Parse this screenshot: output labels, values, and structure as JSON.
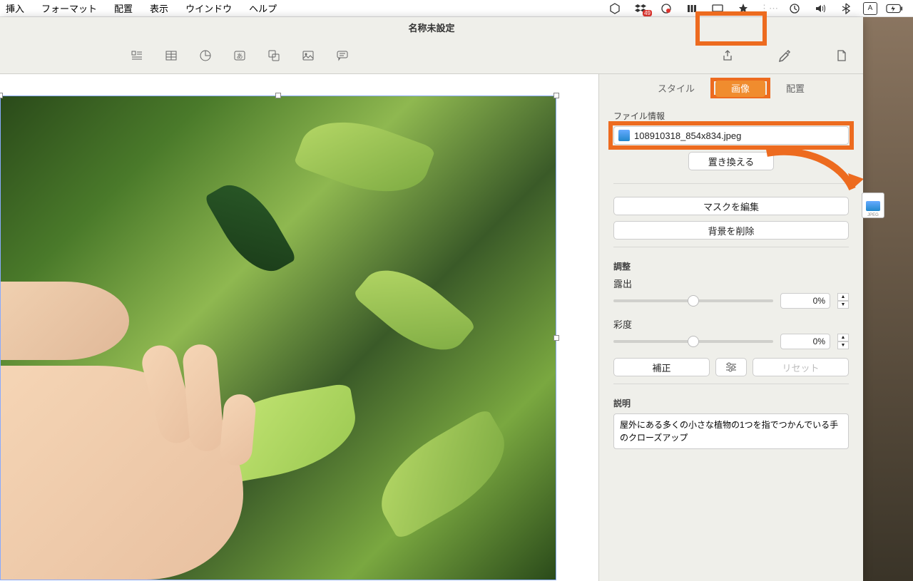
{
  "menubar": {
    "items": [
      "挿入",
      "フォーマット",
      "配置",
      "表示",
      "ウインドウ",
      "ヘルプ"
    ],
    "badge": "49"
  },
  "window": {
    "title": "名称未設定"
  },
  "inspector": {
    "subtabs": {
      "style": "スタイル",
      "image": "画像",
      "arrange": "配置"
    },
    "file_section_label": "ファイル情報",
    "filename": "108910318_854x834.jpeg",
    "replace_btn": "置き換える",
    "mask_btn": "マスクを編集",
    "removebg_btn": "背景を削除",
    "adjust_label": "調整",
    "exposure_label": "露出",
    "exposure_value": "0%",
    "saturation_label": "彩度",
    "saturation_value": "0%",
    "correct_btn": "補正",
    "reset_btn": "リセット",
    "desc_label": "説明",
    "desc_text": "屋外にある多くの小さな植物の1つを指でつかんでいる手のクローズアップ"
  },
  "drag_file_label": "JPEG"
}
